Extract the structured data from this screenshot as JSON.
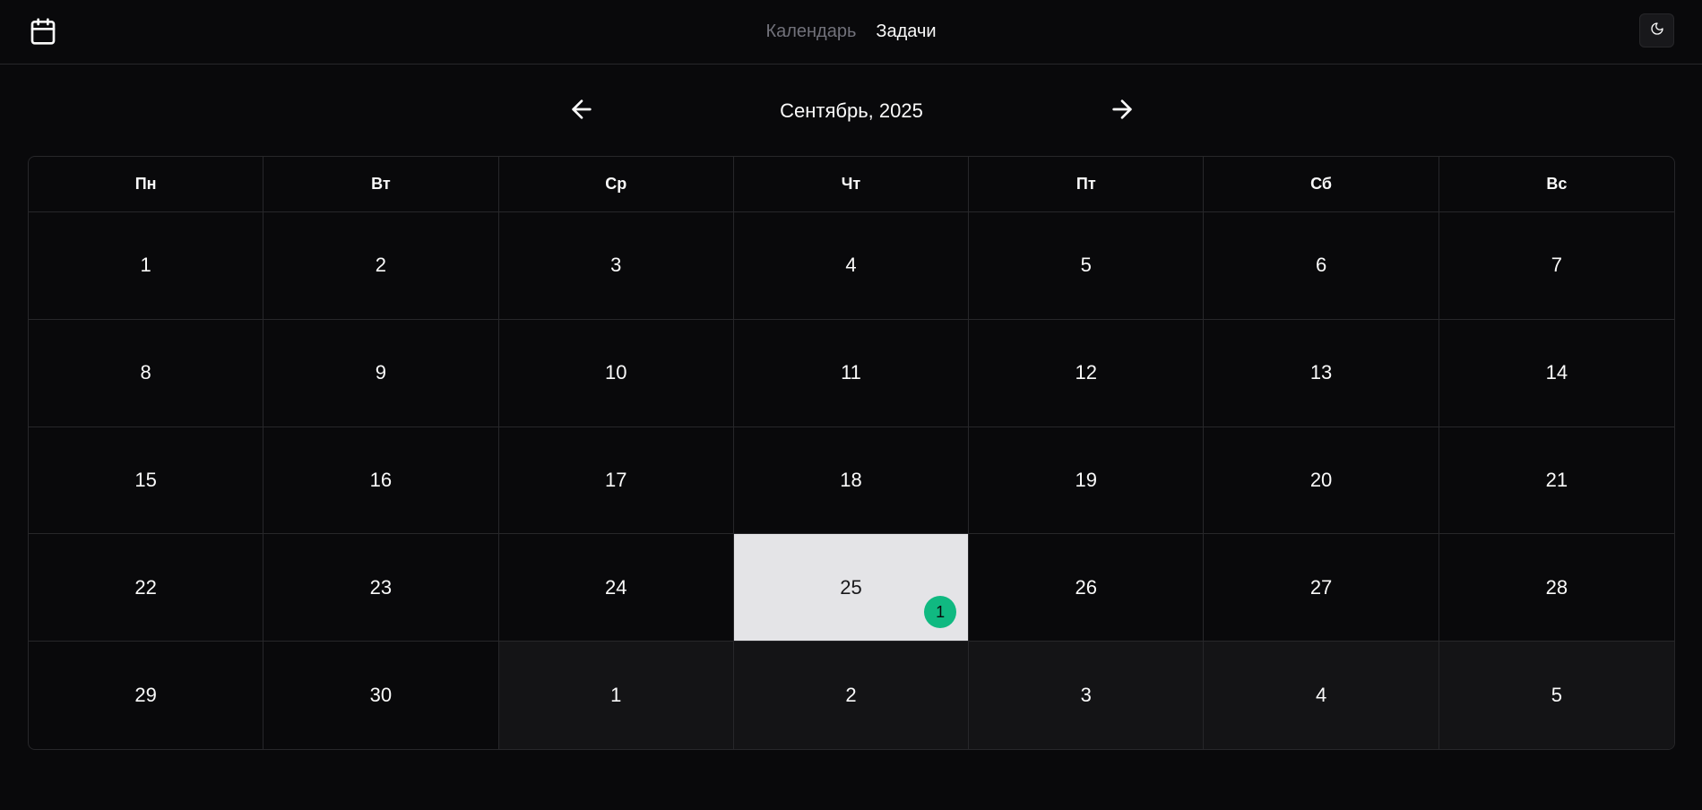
{
  "nav": {
    "calendar_label": "Календарь",
    "tasks_label": "Задачи"
  },
  "month": {
    "title": "Сентябрь, 2025"
  },
  "weekdays": [
    "Пн",
    "Вт",
    "Ср",
    "Чт",
    "Пт",
    "Сб",
    "Вс"
  ],
  "weeks": [
    [
      {
        "day": "1",
        "outside": false
      },
      {
        "day": "2",
        "outside": false
      },
      {
        "day": "3",
        "outside": false
      },
      {
        "day": "4",
        "outside": false
      },
      {
        "day": "5",
        "outside": false
      },
      {
        "day": "6",
        "outside": false
      },
      {
        "day": "7",
        "outside": false
      }
    ],
    [
      {
        "day": "8",
        "outside": false
      },
      {
        "day": "9",
        "outside": false
      },
      {
        "day": "10",
        "outside": false
      },
      {
        "day": "11",
        "outside": false
      },
      {
        "day": "12",
        "outside": false
      },
      {
        "day": "13",
        "outside": false
      },
      {
        "day": "14",
        "outside": false
      }
    ],
    [
      {
        "day": "15",
        "outside": false
      },
      {
        "day": "16",
        "outside": false
      },
      {
        "day": "17",
        "outside": false
      },
      {
        "day": "18",
        "outside": false
      },
      {
        "day": "19",
        "outside": false
      },
      {
        "day": "20",
        "outside": false
      },
      {
        "day": "21",
        "outside": false
      }
    ],
    [
      {
        "day": "22",
        "outside": false
      },
      {
        "day": "23",
        "outside": false
      },
      {
        "day": "24",
        "outside": false
      },
      {
        "day": "25",
        "outside": false,
        "selected": true,
        "task_count": "1"
      },
      {
        "day": "26",
        "outside": false
      },
      {
        "day": "27",
        "outside": false
      },
      {
        "day": "28",
        "outside": false
      }
    ],
    [
      {
        "day": "29",
        "outside": false
      },
      {
        "day": "30",
        "outside": false
      },
      {
        "day": "1",
        "outside": true
      },
      {
        "day": "2",
        "outside": true
      },
      {
        "day": "3",
        "outside": true
      },
      {
        "day": "4",
        "outside": true
      },
      {
        "day": "5",
        "outside": true
      }
    ]
  ],
  "colors": {
    "background": "#09090b",
    "border": "#27272a",
    "outside_month": "#141416",
    "selected": "#e4e4e7",
    "badge": "#10b981",
    "muted_text": "#71717a"
  },
  "icons": {
    "logo": "calendar-icon",
    "theme": "moon-icon",
    "prev": "arrow-left-icon",
    "next": "arrow-right-icon"
  }
}
